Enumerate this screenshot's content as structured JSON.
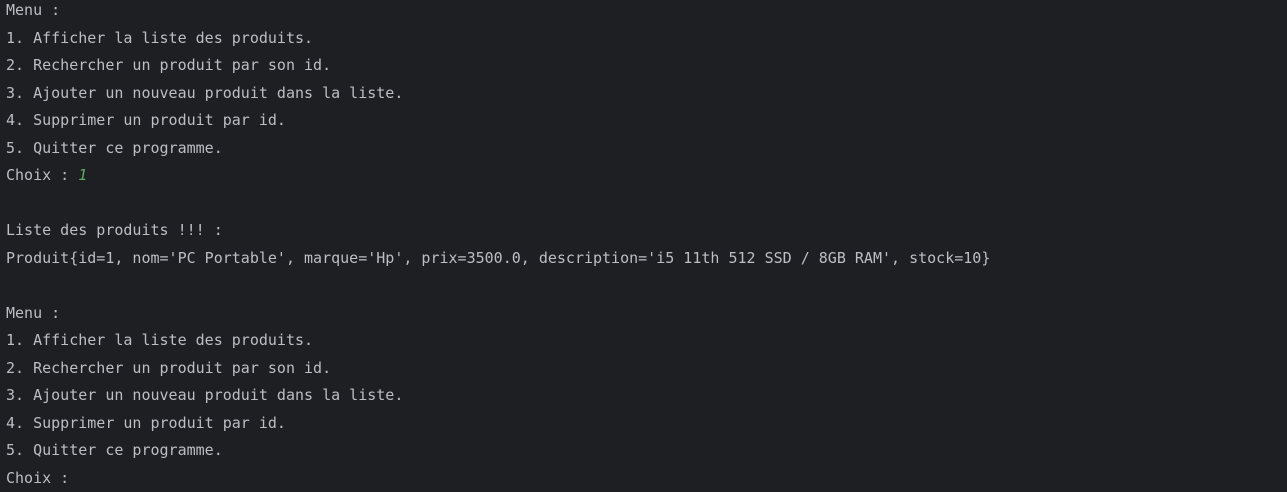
{
  "colors": {
    "background": "#1e1f22",
    "text": "#bcbec4",
    "user_input": "#5fa85f"
  },
  "console": {
    "block1": {
      "menu_header": "Menu :",
      "items": [
        "1. Afficher la liste des produits.",
        "2. Rechercher un produit par son id.",
        "3. Ajouter un nouveau produit dans la liste.",
        "4. Supprimer un produit par id.",
        "5. Quitter ce programme."
      ],
      "choice_prompt": "Choix : ",
      "choice_input": "1"
    },
    "list_header": "Liste des produits !!! :",
    "product_line": "Produit{id=1, nom='PC Portable', marque='Hp', prix=3500.0, description='i5 11th 512 SSD / 8GB RAM', stock=10}",
    "block2": {
      "menu_header": "Menu :",
      "items": [
        "1. Afficher la liste des produits.",
        "2. Rechercher un produit par son id.",
        "3. Ajouter un nouveau produit dans la liste.",
        "4. Supprimer un produit par id.",
        "5. Quitter ce programme."
      ],
      "choice_prompt": "Choix : "
    }
  }
}
